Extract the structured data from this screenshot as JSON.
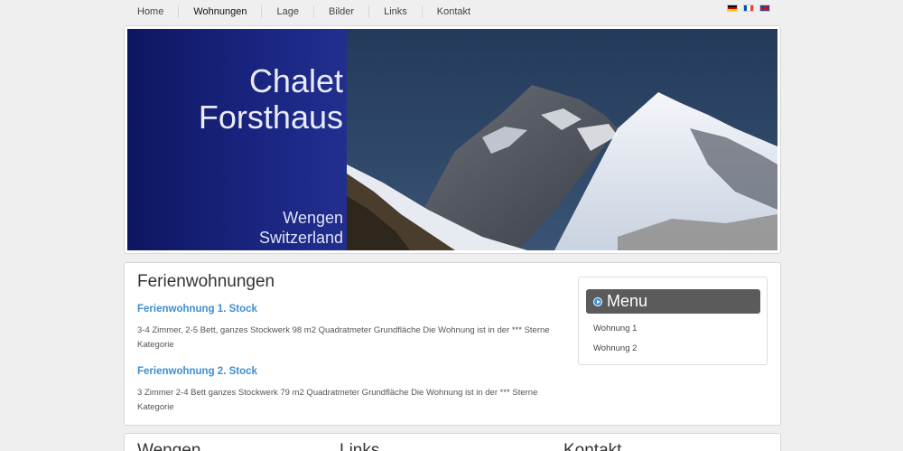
{
  "nav": {
    "items": [
      "Home",
      "Wohnungen",
      "Lage",
      "Bilder",
      "Links",
      "Kontakt"
    ],
    "active": "Wohnungen"
  },
  "flags": [
    "de-flag-icon",
    "fr-flag-icon",
    "gb-flag-icon"
  ],
  "banner": {
    "title_line1": "Chalet",
    "title_line2": "Forsthaus",
    "loc_line1": "Wengen",
    "loc_line2": "Switzerland"
  },
  "main": {
    "heading": "Ferienwohnungen",
    "apartments": [
      {
        "title": "Ferienwohnung 1. Stock",
        "desc_line1": "3-4 Zimmer, 2-5 Bett, ganzes Stockwerk 98 m2 Quadratmeter Grundfläche Die Wohnung ist in der *** Sterne",
        "desc_line2": "Kategorie"
      },
      {
        "title": "Ferienwohnung 2. Stock",
        "desc_line1": "3 Zimmer 2-4 Bett ganzes Stockwerk 79 m2 Quadratmeter Grundfläche Die Wohnung ist in der *** Sterne",
        "desc_line2": "Kategorie"
      }
    ]
  },
  "menu": {
    "title": "Menu",
    "items": [
      "Wohnung 1",
      "Wohnung 2"
    ]
  },
  "footer": {
    "headings": [
      "Wengen",
      "Links",
      "Kontakt"
    ]
  },
  "colors": {
    "accent": "#3c8fd1",
    "banner_blue": "#1a2581",
    "menu_head": "#5b5b5b"
  }
}
